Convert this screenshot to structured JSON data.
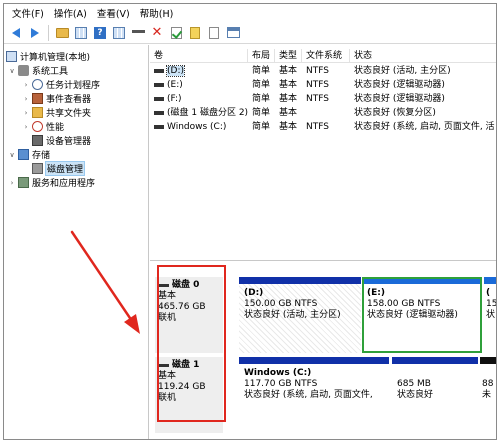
{
  "menu": [
    "文件(F)",
    "操作(A)",
    "查看(V)",
    "帮助(H)"
  ],
  "toolbar_icons": [
    "back-icon",
    "forward-icon",
    "folder-icon",
    "properties-icon",
    "help-icon",
    "grid-icon",
    "key-icon",
    "delete-icon",
    "check-icon",
    "doc-icon",
    "doc-alt-icon",
    "window-icon"
  ],
  "tree": {
    "root": "计算机管理(本地)",
    "system_tools": "系统工具",
    "task_scheduler": "任务计划程序",
    "event_viewer": "事件查看器",
    "shared_folders": "共享文件夹",
    "performance": "性能",
    "device_manager": "设备管理器",
    "storage": "存储",
    "disk_management": "磁盘管理",
    "services": "服务和应用程序"
  },
  "volume_list": {
    "headers": [
      "卷",
      "布局",
      "类型",
      "文件系统",
      "状态"
    ],
    "rows": [
      {
        "name": "(D:)",
        "layout": "简单",
        "type": "基本",
        "fs": "NTFS",
        "status": "状态良好 (活动, 主分区)"
      },
      {
        "name": "(E:)",
        "layout": "简单",
        "type": "基本",
        "fs": "NTFS",
        "status": "状态良好 (逻辑驱动器)"
      },
      {
        "name": "(F:)",
        "layout": "简单",
        "type": "基本",
        "fs": "NTFS",
        "status": "状态良好 (逻辑驱动器)"
      },
      {
        "name": "(磁盘 1 磁盘分区 2)",
        "layout": "简单",
        "type": "基本",
        "fs": "",
        "status": "状态良好 (恢复分区)"
      },
      {
        "name": "Windows (C:)",
        "layout": "简单",
        "type": "基本",
        "fs": "NTFS",
        "status": "状态良好 (系统, 启动, 页面文件, 活"
      }
    ],
    "scroll_glyph": "‹"
  },
  "disks": [
    {
      "name": "磁盘 0",
      "type": "基本",
      "size": "465.76 GB",
      "state": "联机",
      "partitions": [
        {
          "name": "(D:)",
          "size": "150.00 GB NTFS",
          "status": "状态良好 (活动, 主分区)"
        },
        {
          "name": "(E:)",
          "size": "158.00 GB NTFS",
          "status": "状态良好 (逻辑驱动器)"
        },
        {
          "name": "(",
          "size": "15",
          "status": "状"
        }
      ]
    },
    {
      "name": "磁盘 1",
      "type": "基本",
      "size": "119.24 GB",
      "state": "联机",
      "partitions": [
        {
          "name": "Windows  (C:)",
          "size": "117.70 GB NTFS",
          "status": "状态良好 (系统, 启动, 页面文件,"
        },
        {
          "name": "",
          "size": "685 MB",
          "status": "状态良好"
        },
        {
          "name": "",
          "size": "88",
          "status": "未"
        }
      ]
    }
  ],
  "colors": {
    "primary_cap": "#1030a8",
    "logical_outline": "#2fa03a",
    "annotation_red": "#e0271e",
    "unallocated_cap": "#101010"
  }
}
